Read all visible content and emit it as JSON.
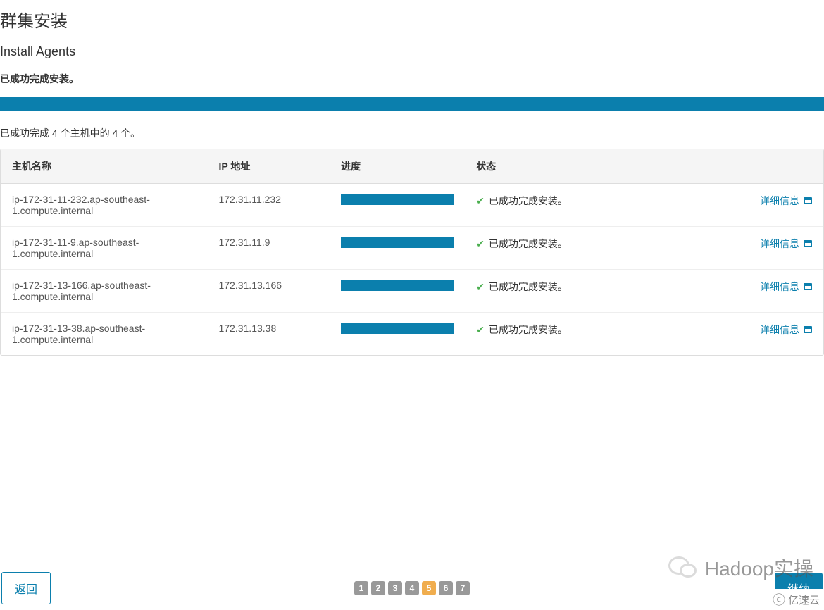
{
  "header": {
    "title": "群集安装",
    "subtitle": "Install Agents",
    "successMessage": "已成功完成安装。"
  },
  "progressSummary": "已成功完成 4 个主机中的 4 个。",
  "table": {
    "headers": {
      "hostname": "主机名称",
      "ip": "IP 地址",
      "progress": "进度",
      "status": "状态"
    },
    "detailsLabel": "详细信息",
    "statusSuccessText": "已成功完成安装。",
    "rows": [
      {
        "hostname": "ip-172-31-11-232.ap-southeast-1.compute.internal",
        "ip": "172.31.11.232"
      },
      {
        "hostname": "ip-172-31-11-9.ap-southeast-1.compute.internal",
        "ip": "172.31.11.9"
      },
      {
        "hostname": "ip-172-31-13-166.ap-southeast-1.compute.internal",
        "ip": "172.31.13.166"
      },
      {
        "hostname": "ip-172-31-13-38.ap-southeast-1.compute.internal",
        "ip": "172.31.13.38"
      }
    ]
  },
  "pagination": {
    "pages": [
      "1",
      "2",
      "3",
      "4",
      "5",
      "6",
      "7"
    ],
    "active": "5"
  },
  "footer": {
    "backLabel": "返回",
    "continueLabel": "继续"
  },
  "watermark": {
    "text": "Hadoop实操",
    "brand": "亿速云"
  }
}
